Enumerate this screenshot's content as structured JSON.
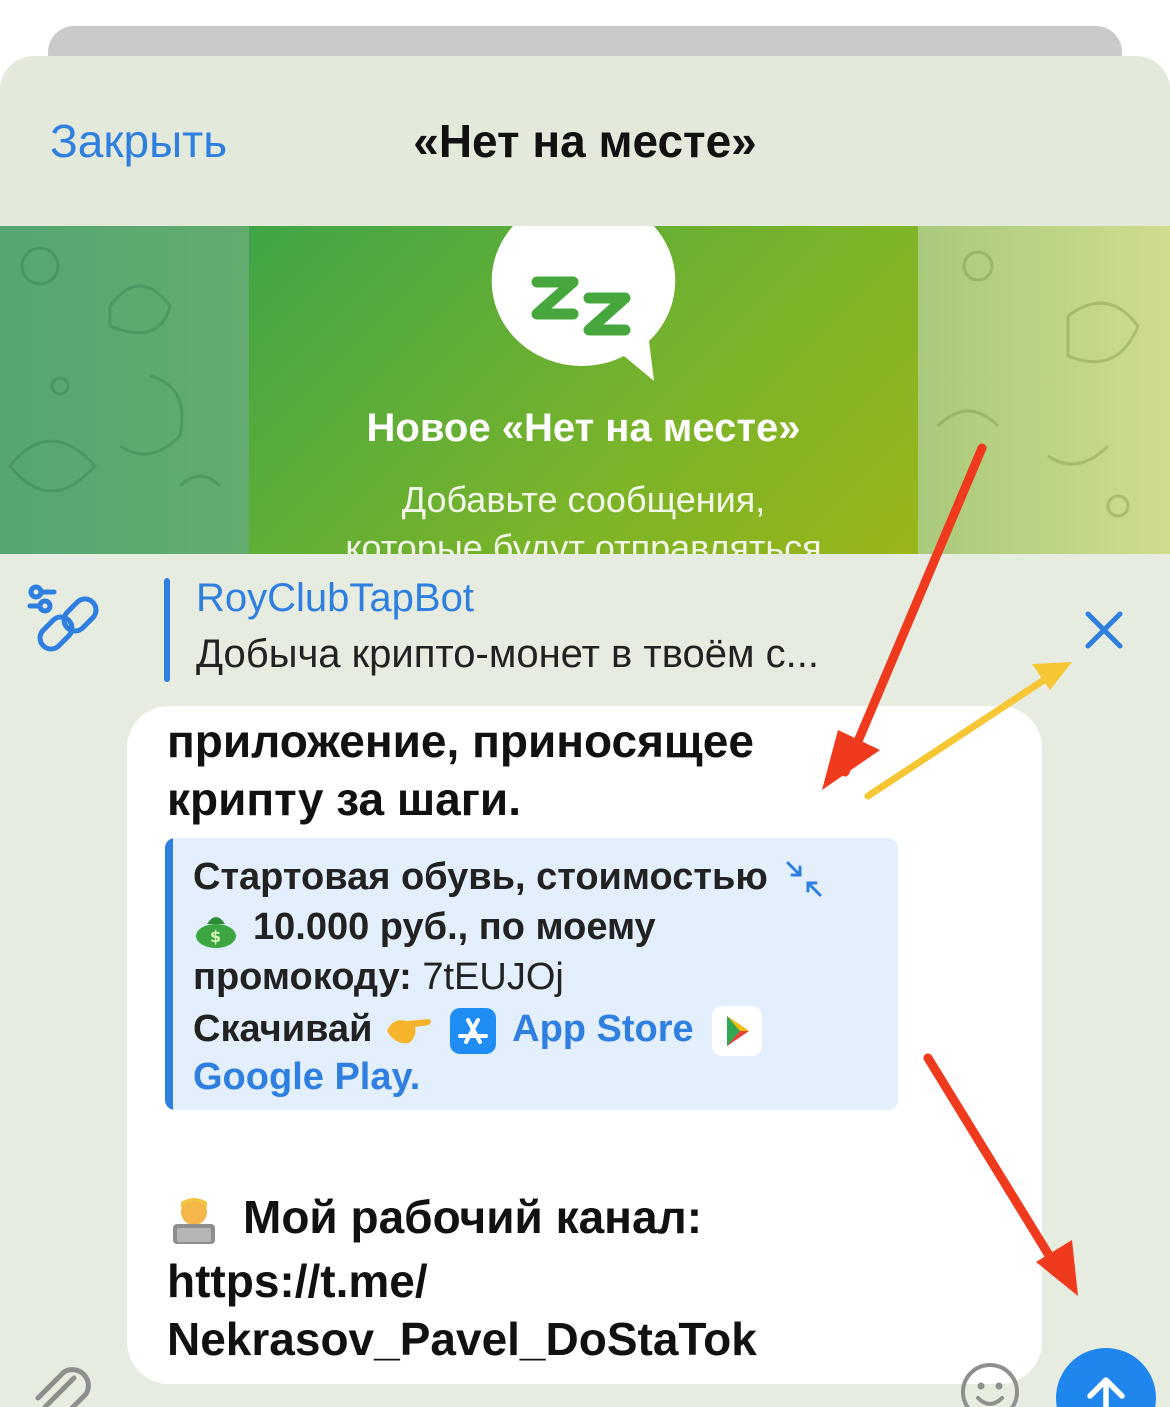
{
  "header": {
    "close_label": "Закрыть",
    "title": "«Нет на месте»"
  },
  "banner": {
    "icon": "zzz-sleep-bubble-icon",
    "title": "Новое «Нет на месте»",
    "text_line1": "Добавьте сообщения,",
    "text_line2": "которые будут отправляться"
  },
  "reply": {
    "icon": "link-settings-icon",
    "name": "RoyClubTapBot",
    "snippet": "Добыча крипто-монет в твоём с..."
  },
  "message": {
    "line1": "приложение, приносящее",
    "line2": "крипту за шаги.",
    "quote": {
      "line1": "Стартовая обувь, стоимостью",
      "line2": "10.000 руб., по моему",
      "line3_label": "промокоду:",
      "promo_code": "7tEUJOj",
      "line4_label": "Скачивай",
      "app_store": "App Store",
      "google_play": "Google Play",
      "google_play_suffix": "."
    },
    "channel_label": "Мой рабочий канал:",
    "channel_url_line1": "https://t.me/",
    "channel_url_line2": "Nekrasov_Pavel_DoStaTok"
  },
  "colors": {
    "accent": "#2f7fe0",
    "send_button": "#1f86ee",
    "annotation_red": "#f03a1e",
    "annotation_yellow": "#f6c634"
  }
}
